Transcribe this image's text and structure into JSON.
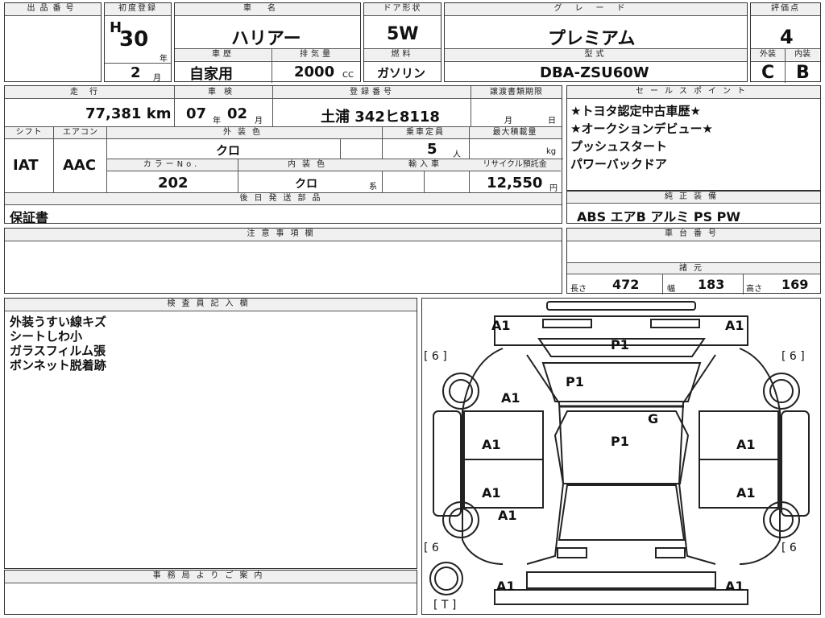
{
  "header": {
    "lot_label": "出品番号",
    "first_reg_label": "初度登録",
    "car_name_label": "車名",
    "door_label": "ドア形状",
    "grade_label": "グレード",
    "score_label": "評価点",
    "history_label": "車歴",
    "displacement_label": "排気量",
    "fuel_label": "燃料",
    "model_label": "型式",
    "exterior_label": "外装",
    "interior_label": "内装"
  },
  "values": {
    "era": "H",
    "year": "30",
    "year_unit": "年",
    "month": "2",
    "month_unit": "月",
    "car_name": "ハリアー",
    "door": "5W",
    "grade": "プレミアム",
    "score": "4",
    "history": "自家用",
    "displacement": "2000",
    "displacement_unit": "CC",
    "fuel": "ガソリン",
    "model": "DBA-ZSU60W",
    "exterior_grade": "C",
    "interior_grade": "B"
  },
  "row2": {
    "mileage_label": "走行",
    "inspection_label": "車検",
    "plate_label": "登録番号",
    "transfer_label": "譲渡書類期限",
    "mileage": "77,381 km",
    "inspection_year": "07",
    "inspection_year_unit": "年",
    "inspection_month": "02",
    "inspection_month_unit": "月",
    "plate": "土浦 342ヒ8118",
    "transfer_month_unit": "月",
    "transfer_day_unit": "日"
  },
  "row3": {
    "shift_label": "シフト",
    "aircon_label": "エアコン",
    "ext_color_label": "外装色",
    "capacity_label": "乗車定員",
    "max_load_label": "最大積載量",
    "shift": "IAT",
    "aircon": "AAC",
    "ext_color": "クロ",
    "capacity": "5",
    "capacity_unit": "人",
    "load_unit": "kg",
    "color_no_label": "カラーNo.",
    "int_color_label": "内装色",
    "import_label": "輸入車",
    "recycle_label": "リサイクル預託金",
    "color_no": "202",
    "int_color": "クロ",
    "int_color_unit": "系",
    "recycle": "12,550",
    "recycle_unit": "円"
  },
  "sales_points": {
    "label": "セールスポイント",
    "items": [
      "★トヨタ認定中古車歴★",
      "★オークションデビュー★",
      "プッシュスタート",
      "パワーバックドア"
    ]
  },
  "parts": {
    "label": "後日発送部品",
    "value": "保証書"
  },
  "equipment": {
    "label": "純正装備",
    "value": "ABS エアB アルミ PS PW"
  },
  "notes": {
    "label": "注意事項欄"
  },
  "chassis": {
    "label": "車台番号",
    "spec_label": "諸元",
    "length_label": "長さ",
    "length": "472",
    "width_label": "幅",
    "width": "183",
    "height_label": "高さ",
    "height": "169"
  },
  "inspector": {
    "label": "検査員記入欄",
    "lines": [
      "外装うすい線キズ",
      "シートしわ小",
      "ガラスフィルム張",
      "ボンネット脱着跡"
    ]
  },
  "office": {
    "label": "事務局よりご案内"
  },
  "diagram": {
    "tire_fl": "[ 6 ]",
    "tire_fr": "[ 6 ]",
    "tire_rl": "[ 6",
    "tire_rr": "[ 6",
    "spare": "[ T ]",
    "marks": [
      "A1",
      "A1",
      "P1",
      "P1",
      "A1",
      "G",
      "A1",
      "P1",
      "A1",
      "A1",
      "A1",
      "A1",
      "A1",
      "A1"
    ]
  }
}
